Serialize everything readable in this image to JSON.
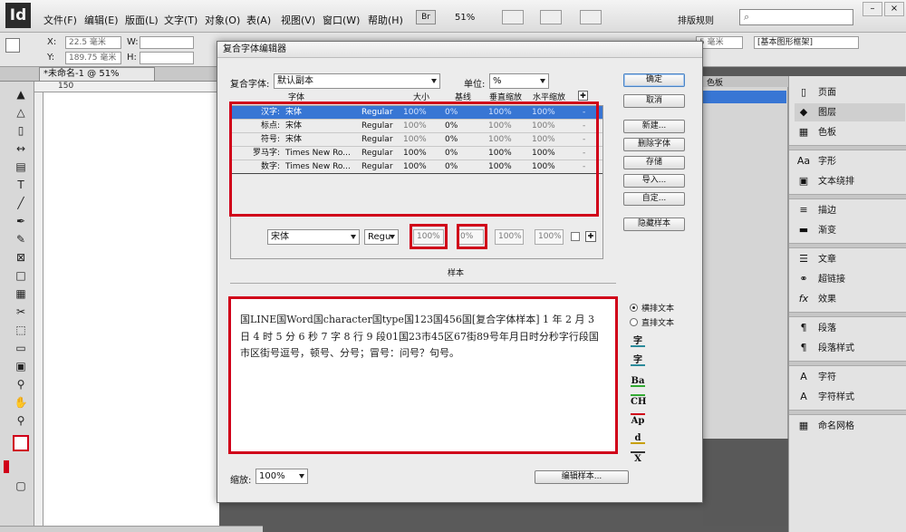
{
  "app": {
    "logo": "Id",
    "menus": [
      "文件(F)",
      "编辑(E)",
      "版面(L)",
      "文字(T)",
      "对象(O)",
      "表(A)",
      "视图(V)",
      "窗口(W)",
      "帮助(H)"
    ],
    "bridge": "Br",
    "zoom": "51%",
    "workspace": "排版规则"
  },
  "control": {
    "x_label": "X:",
    "x_value": "22.5 毫米",
    "y_label": "Y:",
    "y_value": "189.75 毫米",
    "w_label": "W:",
    "h_label": "H:",
    "stroke_value": "5 毫米",
    "frame_style": "[基本图形框架]"
  },
  "document": {
    "tab": "*未命名-1 @ 51%",
    "ruler_tick": "150"
  },
  "dialog": {
    "title": "复合字体编辑器",
    "composite_label": "复合字体:",
    "composite_value": "默认副本",
    "unit_label": "单位:",
    "unit_value": "%",
    "columns": [
      "字体",
      "大小",
      "基线",
      "垂直缩放",
      "水平缩放"
    ],
    "rows": [
      {
        "label": "汉字:",
        "font": "宋体",
        "style": "Regular",
        "size": "100%",
        "baseline": "0%",
        "vscale": "100%",
        "hscale": "100%",
        "dash": "-"
      },
      {
        "label": "标点:",
        "font": "宋体",
        "style": "Regular",
        "size": "100%",
        "baseline": "0%",
        "vscale": "100%",
        "hscale": "100%",
        "dash": "-"
      },
      {
        "label": "符号:",
        "font": "宋体",
        "style": "Regular",
        "size": "100%",
        "baseline": "0%",
        "vscale": "100%",
        "hscale": "100%",
        "dash": "-"
      },
      {
        "label": "罗马字:",
        "font": "Times New Ro...",
        "style": "Regular",
        "size": "100%",
        "baseline": "0%",
        "vscale": "100%",
        "hscale": "100%",
        "dash": "-"
      },
      {
        "label": "数字:",
        "font": "Times New Ro...",
        "style": "Regular",
        "size": "100%",
        "baseline": "0%",
        "vscale": "100%",
        "hscale": "100%",
        "dash": "-"
      }
    ],
    "edit_font": "宋体",
    "edit_style": "Regu",
    "edit_size": "100%",
    "edit_baseline": "0%",
    "edit_vscale": "100%",
    "edit_hscale": "100%",
    "buttons": {
      "ok": "确定",
      "cancel": "取消",
      "new": "新建...",
      "delete": "删除字体",
      "save": "存储",
      "import": "导入...",
      "custom": "自定...",
      "hide": "隐藏样本",
      "edit_sample": "编辑样本..."
    },
    "sample_heading": "样本",
    "sample_text": "国LINE国Word国character国type国123国456国[复合字体样本] 1 年 2 月 3 日 4 时 5 分 6 秒 7 字 8 行 9 段01国23市45区67街89号年月日时分秒字行段国市区街号逗号，顿号、分号；冒号：问号？句号。",
    "horizontal": "横排文本",
    "vertical": "直排文本",
    "sample_icons": [
      "字",
      "字",
      "Ba",
      "CH",
      "Ap",
      "d",
      "X"
    ],
    "zoom_label": "缩放:",
    "zoom_value": "100%"
  },
  "panels": {
    "items": [
      "页面",
      "图层",
      "色板",
      "字形",
      "文本绕排",
      "描边",
      "渐变",
      "文章",
      "超链接",
      "效果",
      "段落",
      "段落样式",
      "字符",
      "字符样式",
      "命名网格"
    ],
    "icons": [
      "page-icon",
      "layers-icon",
      "swatches-icon",
      "glyphs-icon",
      "text-wrap-icon",
      "stroke-icon",
      "gradient-icon",
      "story-icon",
      "hyperlink-icon",
      "effects-icon",
      "paragraph-icon",
      "paragraph-styles-icon",
      "character-icon",
      "character-styles-icon",
      "named-grid-icon"
    ],
    "layer_tab": "色板"
  },
  "colors": {
    "selection": "#3876d4",
    "highlight": "#d00019",
    "accent": "#4a84c5"
  }
}
